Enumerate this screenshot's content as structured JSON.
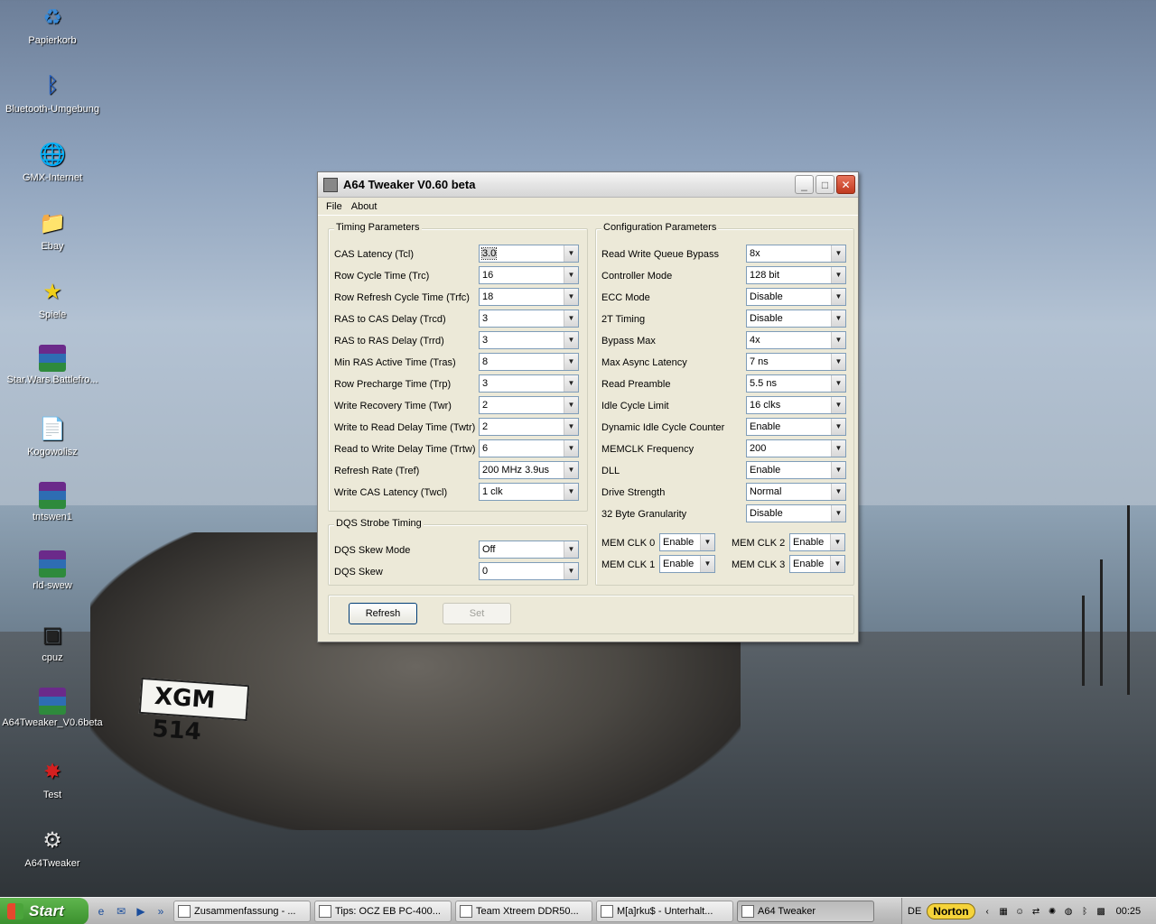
{
  "desktop": {
    "icons": [
      {
        "label": "Papierkorb",
        "glyph": "♻",
        "color": "#3a8ad6"
      },
      {
        "label": "Bluetooth-Umgebung",
        "glyph": "ᛒ",
        "color": "#1f5fc9"
      },
      {
        "label": "GMX-Internet",
        "glyph": "🌐",
        "color": "#2d7cc0"
      },
      {
        "label": "Ebay",
        "glyph": "📁",
        "color": "#e6c23a"
      },
      {
        "label": "Spiele",
        "glyph": "★",
        "color": "#f1cf1a"
      },
      {
        "label": "Star.Wars.Battlefro...",
        "glyph": "",
        "color": ""
      },
      {
        "label": "Kogowolisz",
        "glyph": "📄",
        "color": "#ffffff"
      },
      {
        "label": "tntswen1",
        "glyph": "",
        "color": ""
      },
      {
        "label": "rld-swew",
        "glyph": "",
        "color": ""
      },
      {
        "label": "cpuz",
        "glyph": "▣",
        "color": "#222222"
      },
      {
        "label": "A64Tweaker_V0.6beta",
        "glyph": "",
        "color": ""
      },
      {
        "label": "Test",
        "glyph": "✸",
        "color": "#d42020"
      },
      {
        "label": "A64Tweaker",
        "glyph": "⚙",
        "color": "#dddddd"
      }
    ],
    "license_plate": "XGM 514"
  },
  "window": {
    "title": "A64 Tweaker V0.60 beta",
    "controls": {
      "minimize": "_",
      "maximize": "□",
      "close": "✕"
    },
    "menu": [
      "File",
      "About"
    ],
    "timing": {
      "title": "Timing Parameters",
      "rows": [
        {
          "label": "CAS Latency (Tcl)",
          "value": "3.0"
        },
        {
          "label": "Row Cycle Time (Trc)",
          "value": "16"
        },
        {
          "label": "Row Refresh Cycle Time (Trfc)",
          "value": "18"
        },
        {
          "label": "RAS to CAS Delay (Trcd)",
          "value": "3"
        },
        {
          "label": "RAS to RAS Delay (Trrd)",
          "value": "3"
        },
        {
          "label": "Min RAS Active Time (Tras)",
          "value": "8"
        },
        {
          "label": "Row Precharge Time (Trp)",
          "value": "3"
        },
        {
          "label": "Write Recovery Time (Twr)",
          "value": "2"
        },
        {
          "label": "Write to Read Delay Time (Twtr)",
          "value": "2"
        },
        {
          "label": "Read to Write Delay Time (Trtw)",
          "value": "6"
        },
        {
          "label": "Refresh Rate (Tref)",
          "value": "200 MHz 3.9us"
        },
        {
          "label": "Write CAS Latency (Twcl)",
          "value": "1 clk"
        }
      ]
    },
    "dqs": {
      "title": "DQS Strobe Timing",
      "rows": [
        {
          "label": "DQS Skew Mode",
          "value": "Off"
        },
        {
          "label": "DQS Skew",
          "value": "0"
        }
      ]
    },
    "config": {
      "title": "Configuration Parameters",
      "rows": [
        {
          "label": "Read Write Queue Bypass",
          "value": "8x"
        },
        {
          "label": "Controller Mode",
          "value": "128 bit"
        },
        {
          "label": "ECC Mode",
          "value": "Disable"
        },
        {
          "label": "2T Timing",
          "value": "Disable"
        },
        {
          "label": "Bypass Max",
          "value": "4x"
        },
        {
          "label": "Max Async Latency",
          "value": "7 ns"
        },
        {
          "label": "Read Preamble",
          "value": "5.5 ns"
        },
        {
          "label": "Idle Cycle Limit",
          "value": "16 clks"
        },
        {
          "label": "Dynamic Idle Cycle Counter",
          "value": "Enable"
        },
        {
          "label": "MEMCLK Frequency",
          "value": "200"
        },
        {
          "label": "DLL",
          "value": "Enable"
        },
        {
          "label": "Drive Strength",
          "value": "Normal"
        },
        {
          "label": "32 Byte Granularity",
          "value": "Disable"
        }
      ],
      "memclk": [
        {
          "label": "MEM CLK 0",
          "value": "Enable"
        },
        {
          "label": "MEM CLK 2",
          "value": "Enable"
        },
        {
          "label": "MEM CLK 1",
          "value": "Enable"
        },
        {
          "label": "MEM CLK 3",
          "value": "Enable"
        }
      ]
    },
    "buttons": {
      "refresh": "Refresh",
      "set": "Set"
    }
  },
  "taskbar": {
    "start": "Start",
    "quick_launch": [
      "ie-icon",
      "outlook-icon",
      "media-icon"
    ],
    "overflow": "»",
    "tasks": [
      {
        "label": "Zusammenfassung - ...",
        "active": false
      },
      {
        "label": "Tips: OCZ EB PC-400...",
        "active": false
      },
      {
        "label": "Team Xtreem DDR50...",
        "active": false
      },
      {
        "label": "M[a]rku$ - Unterhalt...",
        "active": false
      },
      {
        "label": "A64 Tweaker",
        "active": true
      }
    ],
    "tray": {
      "language": "DE",
      "norton": "Norton",
      "clock": "00:25"
    }
  }
}
